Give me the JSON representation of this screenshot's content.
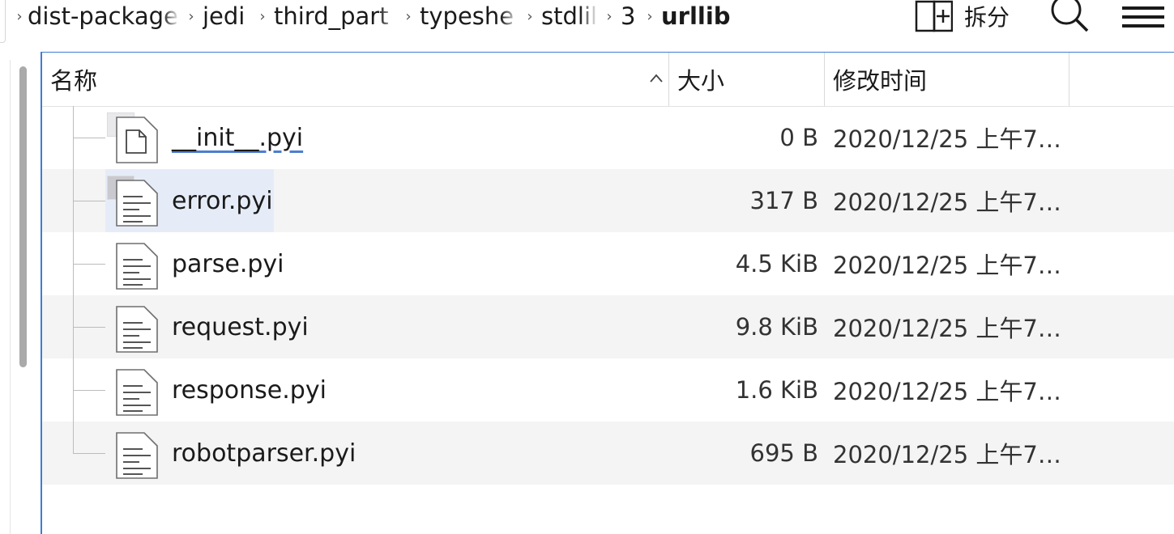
{
  "breadcrumb": {
    "items": [
      {
        "label": "dist-package",
        "width": 188,
        "fade": true
      },
      {
        "label": "jedi",
        "width": 60,
        "fade": false
      },
      {
        "label": "third_part",
        "width": 152,
        "fade": true
      },
      {
        "label": "typeshe",
        "width": 122,
        "fade": true
      },
      {
        "label": "stdlil",
        "width": 70,
        "fade": true
      },
      {
        "label": "3",
        "width": 22,
        "fade": false
      }
    ],
    "current": "urllib"
  },
  "toolbar": {
    "split_label": "拆分",
    "split_icon": "split-view-icon",
    "search_icon": "search-icon",
    "menu_icon": "hamburger-menu-icon"
  },
  "columns": {
    "name": "名称",
    "size": "大小",
    "modified": "修改时间",
    "sort_icon": "sort-ascending-icon"
  },
  "files": [
    {
      "name": "__init__.py",
      "display": "__init__.pyi",
      "size": "0 B",
      "modified": "2020/12/25 上午7…",
      "icon": "blank-file-icon"
    },
    {
      "name": "error.pyi",
      "size": "317 B",
      "modified": "2020/12/25 上午7…",
      "icon": "text-file-icon"
    },
    {
      "name": "parse.pyi",
      "size": "4.5 KiB",
      "modified": "2020/12/25 上午7…",
      "icon": "text-file-icon"
    },
    {
      "name": "request.pyi",
      "size": "9.8 KiB",
      "modified": "2020/12/25 上午7…",
      "icon": "text-file-icon"
    },
    {
      "name": "response.pyi",
      "size": "1.6 KiB",
      "modified": "2020/12/25 上午7…",
      "icon": "text-file-icon"
    },
    {
      "name": "robotparser.pyi",
      "size": "695 B",
      "modified": "2020/12/25 上午7…",
      "icon": "text-file-icon"
    }
  ],
  "colors": {
    "accent": "#3c7ed2",
    "selection": "#e6ecf7",
    "alt_row": "#f4f4f4"
  }
}
